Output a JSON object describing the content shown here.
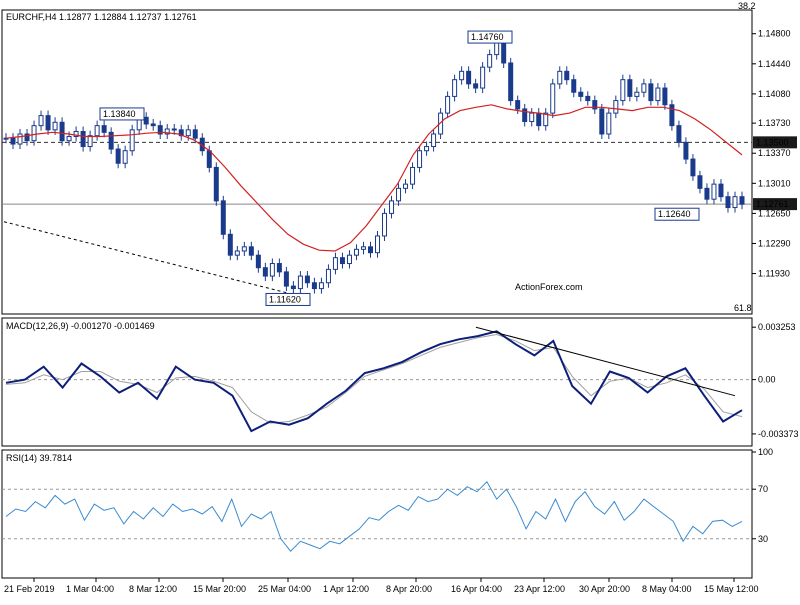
{
  "chart_data": [
    {
      "type": "line",
      "title": "EURCHF,H4  1.12877 1.12884 1.12737 1.12761",
      "subtype": "candlestick",
      "y_scale": {
        "top": 1.1506,
        "bottom": 1.1147
      },
      "yticks": [
        "1.14800",
        "1.14440",
        "1.14080",
        "1.13730",
        "1.13370",
        "1.13010",
        "1.12650",
        "1.12290",
        "1.11930"
      ],
      "ytick_values": [
        1.148,
        1.1444,
        1.1408,
        1.1373,
        1.1337,
        1.1301,
        1.1265,
        1.1229,
        1.1193
      ],
      "fib_top_label": "38.2",
      "fib_bottom_label": "61.8",
      "horizontal_levels": [
        {
          "value": 1.135,
          "label": "1.13500",
          "style": "dashed"
        },
        {
          "value": 1.12761,
          "label": "1.12761",
          "style": "solid"
        }
      ],
      "annotations": [
        {
          "text": "1.13840",
          "value": 1.1384
        },
        {
          "text": "1.14760",
          "value": 1.1476
        },
        {
          "text": "1.11620",
          "value": 1.1162
        },
        {
          "text": "1.12640",
          "value": 1.1264
        }
      ],
      "trendline": {
        "from": 1.1255,
        "to": 1.1163
      },
      "series": [
        {
          "name": "EURCHF",
          "color": "#1a3a8c",
          "values": [
            1.1355,
            1.1348,
            1.136,
            1.1352,
            1.137,
            1.1382,
            1.1365,
            1.1374,
            1.1352,
            1.1357,
            1.1363,
            1.1345,
            1.1358,
            1.137,
            1.1362,
            1.1342,
            1.1325,
            1.134,
            1.1365,
            1.138,
            1.1372,
            1.137,
            1.136,
            1.1366,
            1.1365,
            1.1358,
            1.1365,
            1.1355,
            1.134,
            1.132,
            1.128,
            1.124,
            1.1215,
            1.122,
            1.1225,
            1.1215,
            1.12,
            1.119,
            1.1205,
            1.1195,
            1.1178,
            1.1175,
            1.119,
            1.1182,
            1.1175,
            1.1182,
            1.1198,
            1.1212,
            1.1205,
            1.1215,
            1.1222,
            1.1225,
            1.1218,
            1.1238,
            1.1265,
            1.128,
            1.1295,
            1.13,
            1.132,
            1.134,
            1.1345,
            1.136,
            1.1385,
            1.1405,
            1.1425,
            1.1435,
            1.142,
            1.1415,
            1.144,
            1.1455,
            1.147,
            1.1445,
            1.14,
            1.139,
            1.1375,
            1.1385,
            1.137,
            1.1385,
            1.142,
            1.1435,
            1.1425,
            1.141,
            1.1405,
            1.14,
            1.139,
            1.136,
            1.1385,
            1.14,
            1.1425,
            1.1405,
            1.141,
            1.142,
            1.14,
            1.1415,
            1.1395,
            1.137,
            1.135,
            1.133,
            1.131,
            1.1295,
            1.1282,
            1.13,
            1.1285,
            1.1272,
            1.1285,
            1.1276
          ]
        },
        {
          "name": "MA",
          "color": "#d42020",
          "values": [
            1.1355,
            1.1357,
            1.136,
            1.1362,
            1.136,
            1.1357,
            1.1357,
            1.1358,
            1.1359,
            1.1361,
            1.1362,
            1.136,
            1.1353,
            1.134,
            1.132,
            1.1298,
            1.1278,
            1.1258,
            1.124,
            1.1228,
            1.1221,
            1.122,
            1.123,
            1.125,
            1.1275,
            1.13,
            1.1335,
            1.136,
            1.1378,
            1.1388,
            1.1392,
            1.1395,
            1.139,
            1.1387,
            1.1385,
            1.1382,
            1.1385,
            1.1392,
            1.1392,
            1.139,
            1.1388,
            1.1392,
            1.1392,
            1.1388,
            1.1378,
            1.1365,
            1.135,
            1.1335
          ]
        }
      ]
    },
    {
      "type": "line",
      "title": "MACD(12,26,9) -0.001270 -0.001469",
      "y_scale": {
        "top": 0.0037,
        "bottom": -0.004
      },
      "yticks": [
        "0.003253",
        "0.00",
        "-0.003373"
      ],
      "ytick_values": [
        0.003253,
        0.0,
        -0.003373
      ],
      "trendline": {
        "from": 0.00325,
        "to": -0.001
      },
      "series": [
        {
          "name": "MACD",
          "color": "#0d1f7a",
          "values": [
            -0.0002,
            0.0,
            0.0008,
            -0.0005,
            0.001,
            0.0002,
            -0.0008,
            -0.0002,
            -0.0012,
            0.0008,
            0.0,
            -0.0002,
            -0.001,
            -0.0032,
            -0.0026,
            -0.0028,
            -0.0024,
            -0.0015,
            -0.0007,
            0.0004,
            0.0007,
            0.0011,
            0.0017,
            0.0022,
            0.0025,
            0.0027,
            0.003,
            0.0022,
            0.0015,
            0.0024,
            -0.0004,
            -0.0015,
            0.0005,
            0.0001,
            -0.0008,
            0.0002,
            0.0007,
            -0.001,
            -0.0026,
            -0.0019
          ]
        },
        {
          "name": "Signal",
          "color": "#a0a0a0",
          "values": [
            -0.0003,
            -0.0002,
            0.0003,
            0.0,
            0.0005,
            0.0005,
            -0.0001,
            -0.0003,
            -0.0008,
            0.0001,
            0.0002,
            -0.0001,
            -0.0005,
            -0.002,
            -0.0027,
            -0.0026,
            -0.0022,
            -0.0017,
            -0.0008,
            0.0002,
            0.0006,
            0.001,
            0.0015,
            0.002,
            0.0023,
            0.0026,
            0.0028,
            0.0024,
            0.0018,
            0.002,
            0.0002,
            -0.001,
            -0.0001,
            0.0001,
            -0.0005,
            -0.0002,
            0.0003,
            -0.0006,
            -0.002,
            -0.0023
          ]
        }
      ]
    },
    {
      "type": "line",
      "title": "RSI(14) 39.7814",
      "y_scale": {
        "top": 100,
        "bottom": 0
      },
      "yticks": [
        "100",
        "70",
        "30"
      ],
      "ytick_values": [
        100,
        70,
        30
      ],
      "series": [
        {
          "name": "RSI",
          "color": "#3a8bd0",
          "values": [
            48,
            54,
            52,
            60,
            55,
            65,
            58,
            62,
            45,
            58,
            53,
            55,
            42,
            52,
            46,
            55,
            48,
            58,
            52,
            54,
            50,
            56,
            44,
            62,
            40,
            50,
            46,
            52,
            30,
            20,
            28,
            25,
            22,
            28,
            26,
            32,
            38,
            47,
            45,
            52,
            57,
            53,
            64,
            60,
            62,
            70,
            65,
            72,
            68,
            76,
            62,
            70,
            56,
            38,
            52,
            46,
            62,
            44,
            60,
            68,
            56,
            50,
            60,
            45,
            52,
            62,
            56,
            50,
            44,
            28,
            40,
            34,
            44,
            45,
            40,
            44
          ]
        }
      ]
    }
  ],
  "x_axis": {
    "labels": [
      "21 Feb 2019",
      "1 Mar 04:00",
      "8 Mar 12:00",
      "15 Mar 20:00",
      "25 Mar 04:00",
      "1 Apr 12:00",
      "8 Apr 20:00",
      "16 Apr 04:00",
      "23 Apr 12:00",
      "30 Apr 20:00",
      "8 May 04:00",
      "15 May 12:00"
    ]
  },
  "watermark": "ActionForex.com",
  "colors": {
    "price": "#1a3a8c",
    "ma": "#d42020",
    "macd": "#0d1f7a",
    "signal": "#a0a0a0",
    "rsi": "#3a8bd0",
    "label_box": "#1a3a8c"
  }
}
